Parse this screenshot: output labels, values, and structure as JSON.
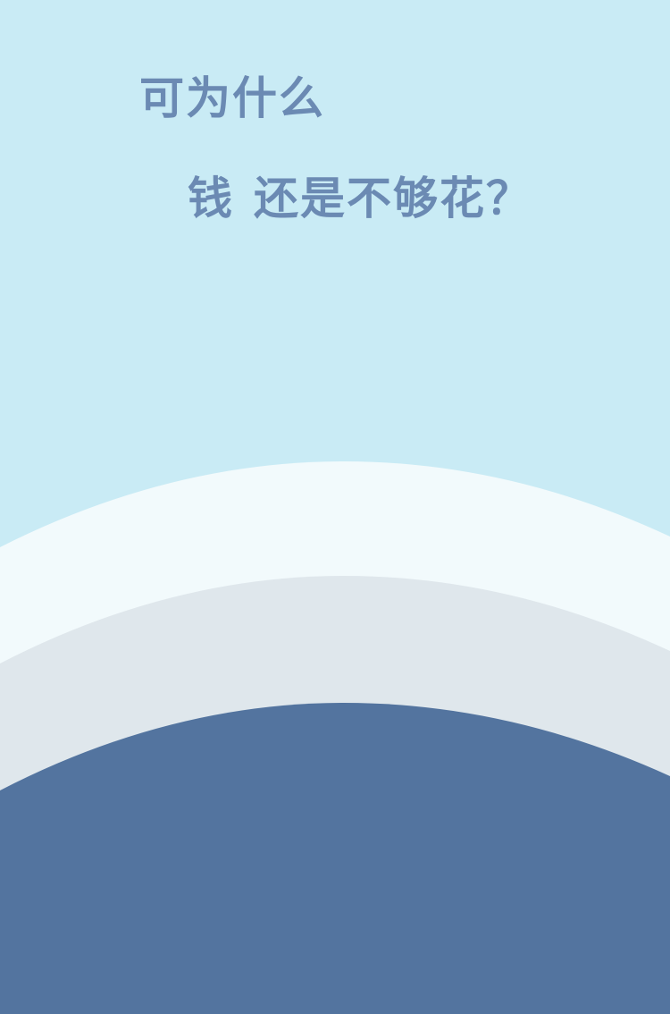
{
  "headline": {
    "line1": "可为什么",
    "line2_part1": "钱",
    "line2_part2": "还是不够花？"
  },
  "colors": {
    "background": "#c9ebf5",
    "text": "#6b8ab3",
    "wave_light": "#f2fafc",
    "wave_mid": "#dfe7ec",
    "wave_dark": "#53749f"
  }
}
